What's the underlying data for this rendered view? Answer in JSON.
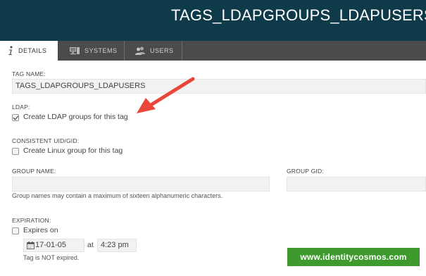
{
  "header": {
    "title": "TAGS_LDAPGROUPS_LDAPUSERS"
  },
  "tabs": [
    {
      "label": "DETAILS",
      "icon": "info-icon",
      "active": true
    },
    {
      "label": "SYSTEMS",
      "icon": "computer-icon",
      "active": false
    },
    {
      "label": "USERS",
      "icon": "users-icon",
      "active": false
    }
  ],
  "form": {
    "tag_name_label": "TAG NAME:",
    "tag_name_value": "TAGS_LDAPGROUPS_LDAPUSERS",
    "ldap_label": "LDAP:",
    "ldap_checkbox_label": "Create LDAP groups for this tag",
    "ldap_checked": true,
    "uid_label": "CONSISTENT UID/GID:",
    "uid_checkbox_label": "Create Linux group for this tag",
    "uid_checked": false,
    "group_name_label": "GROUP NAME:",
    "group_name_value": "",
    "group_name_hint": "Group names may contain a maximum of sixteen alphanumeric characters.",
    "group_gid_label": "GROUP GID:",
    "group_gid_value": "",
    "expiration_label": "EXPIRATION:",
    "expires_checkbox_label": "Expires on",
    "expires_checked": false,
    "expiry_date": "17-01-05",
    "at_label": "at",
    "expiry_time": "4:23 pm",
    "expiry_status": "Tag is NOT expired."
  },
  "watermark": {
    "text": "www.identitycosmos.com"
  },
  "colors": {
    "header_bg": "#0f3a4a",
    "tabbar_bg": "#4b4b4b",
    "annotation_arrow": "#e8473a",
    "watermark_bg": "#3f9a2e"
  }
}
